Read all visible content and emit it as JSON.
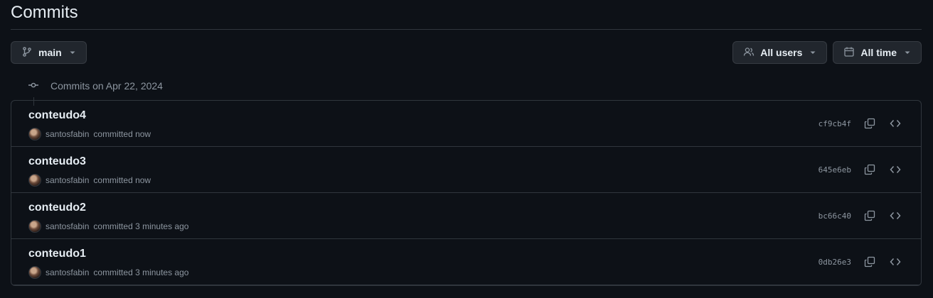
{
  "page": {
    "title": "Commits"
  },
  "toolbar": {
    "branch_label": "main",
    "users_label": "All users",
    "time_label": "All time"
  },
  "group": {
    "header": "Commits on Apr 22, 2024"
  },
  "commits": [
    {
      "title": "conteudo4",
      "author": "santosfabin",
      "meta": "committed now",
      "sha": "cf9cb4f"
    },
    {
      "title": "conteudo3",
      "author": "santosfabin",
      "meta": "committed now",
      "sha": "645e6eb"
    },
    {
      "title": "conteudo2",
      "author": "santosfabin",
      "meta": "committed 3 minutes ago",
      "sha": "bc66c40"
    },
    {
      "title": "conteudo1",
      "author": "santosfabin",
      "meta": "committed 3 minutes ago",
      "sha": "0db26e3"
    }
  ],
  "icons": {
    "branch": "git-branch-icon",
    "users": "people-icon",
    "calendar": "calendar-icon",
    "caret": "triangle-down-icon",
    "commit": "git-commit-icon",
    "copy": "copy-icon",
    "code": "code-icon"
  }
}
